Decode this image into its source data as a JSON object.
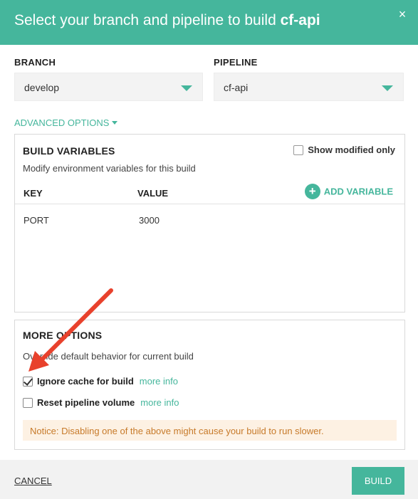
{
  "header": {
    "title_prefix": "Select your branch and pipeline to build ",
    "repo": "cf-api",
    "close_symbol": "×"
  },
  "branch": {
    "label": "BRANCH",
    "value": "develop"
  },
  "pipeline": {
    "label": "PIPELINE",
    "value": "cf-api"
  },
  "advanced_options": {
    "label": "ADVANCED OPTIONS"
  },
  "build_variables": {
    "title": "BUILD VARIABLES",
    "subtitle": "Modify environment variables for this build",
    "show_modified_label": "Show modified only",
    "show_modified_checked": false,
    "columns": {
      "key": "KEY",
      "value": "VALUE"
    },
    "add_variable_label": "ADD VARIABLE",
    "add_variable_symbol": "+",
    "rows": [
      {
        "key": "PORT",
        "value": "3000"
      }
    ]
  },
  "more_options": {
    "title": "MORE OPTIONS",
    "subtitle": "Override default behavior for current build",
    "options": [
      {
        "label": "Ignore cache for build",
        "info": "more info",
        "checked": true
      },
      {
        "label": "Reset pipeline volume",
        "info": "more info",
        "checked": false
      }
    ],
    "notice": "Notice: Disabling one of the above might cause your build to run slower."
  },
  "footer": {
    "cancel_label": "CANCEL",
    "build_label": "BUILD"
  },
  "colors": {
    "accent": "#45b69c",
    "notice_bg": "#fdf1e3",
    "notice_text": "#c77a2a",
    "annotation_arrow": "#e8412c"
  }
}
